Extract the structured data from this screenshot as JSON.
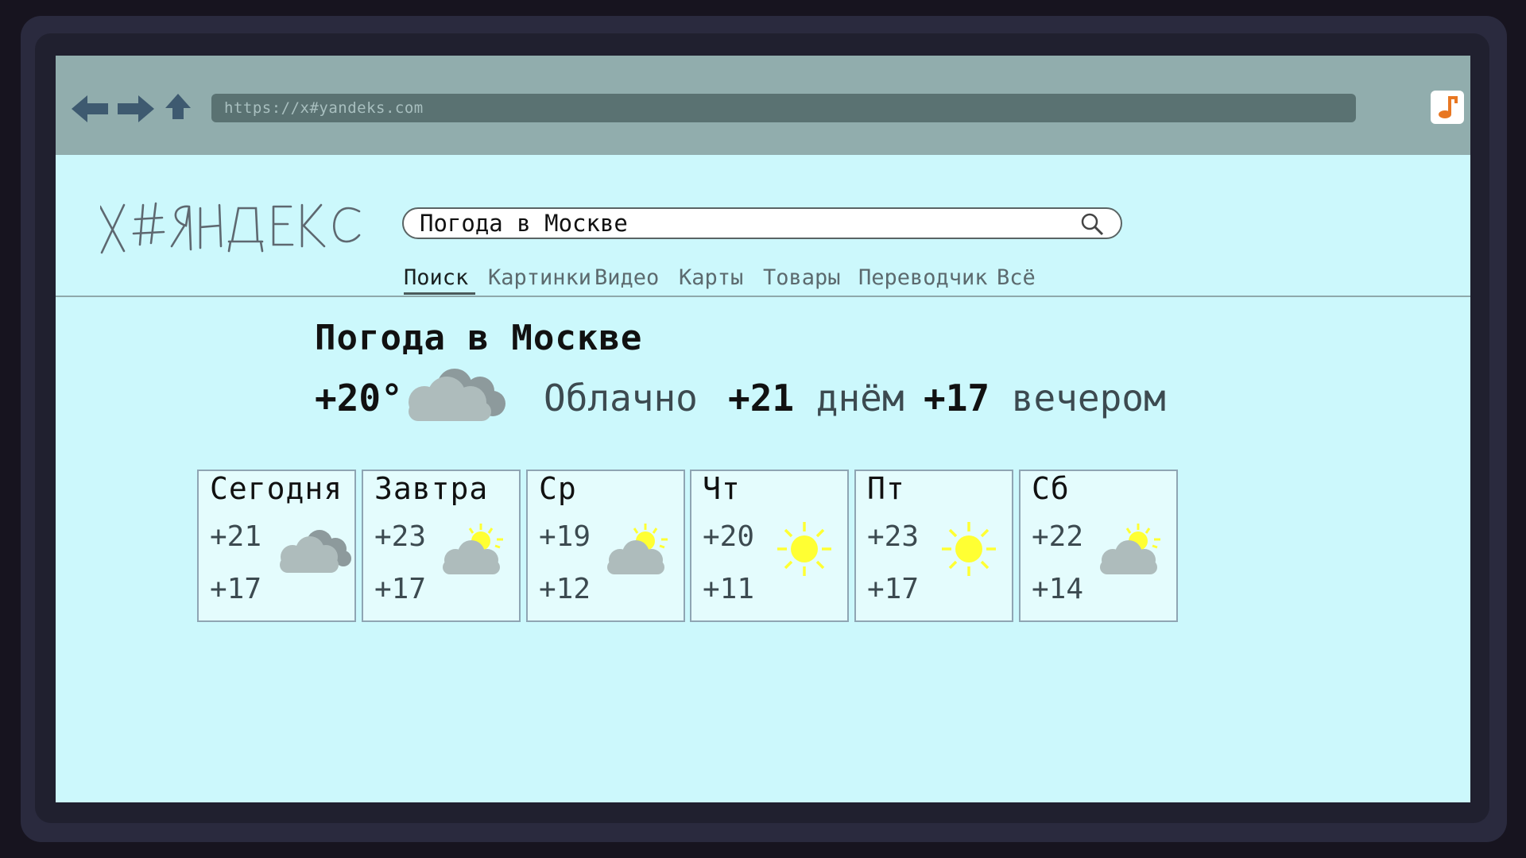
{
  "browser": {
    "url": "https://x#yandeks.com",
    "back_icon": "arrow-left-icon",
    "forward_icon": "arrow-right-icon",
    "up_icon": "arrow-up-icon",
    "extension_icon": "music-note-icon"
  },
  "logo": {
    "text": "X#ЯНДЕКС"
  },
  "search": {
    "query": "Погода в Москве",
    "icon": "search-icon"
  },
  "tabs": [
    {
      "label": "Поиск",
      "active": true
    },
    {
      "label": "Картинки"
    },
    {
      "label": "Видео"
    },
    {
      "label": "Карты"
    },
    {
      "label": "Товары"
    },
    {
      "label": "Переводчик"
    },
    {
      "label": "Всё"
    }
  ],
  "weather": {
    "title": "Погода в Москве",
    "current_temp": "+20°",
    "current_icon": "cloud-icon",
    "condition": "Облачно",
    "day_temp": "+21",
    "day_label": "днём",
    "evening_temp": "+17",
    "evening_label": "вечером",
    "forecast": [
      {
        "day": "Сегодня",
        "high": "+21",
        "low": "+17",
        "icon": "cloud-icon"
      },
      {
        "day": "Завтра",
        "high": "+23",
        "low": "+17",
        "icon": "partly-cloudy-icon"
      },
      {
        "day": "Ср",
        "high": "+19",
        "low": "+12",
        "icon": "partly-cloudy-icon"
      },
      {
        "day": "Чт",
        "high": "+20",
        "low": "+11",
        "icon": "sun-icon"
      },
      {
        "day": "Пт",
        "high": "+23",
        "low": "+17",
        "icon": "sun-icon"
      },
      {
        "day": "Сб",
        "high": "+22",
        "low": "+14",
        "icon": "partly-cloudy-icon"
      }
    ]
  },
  "colors": {
    "page_background": "#ccf8fc",
    "toolbar": "#91adad",
    "url_bar": "#5a7272",
    "sun": "#ffff33",
    "cloud": "#a9b6b6"
  }
}
